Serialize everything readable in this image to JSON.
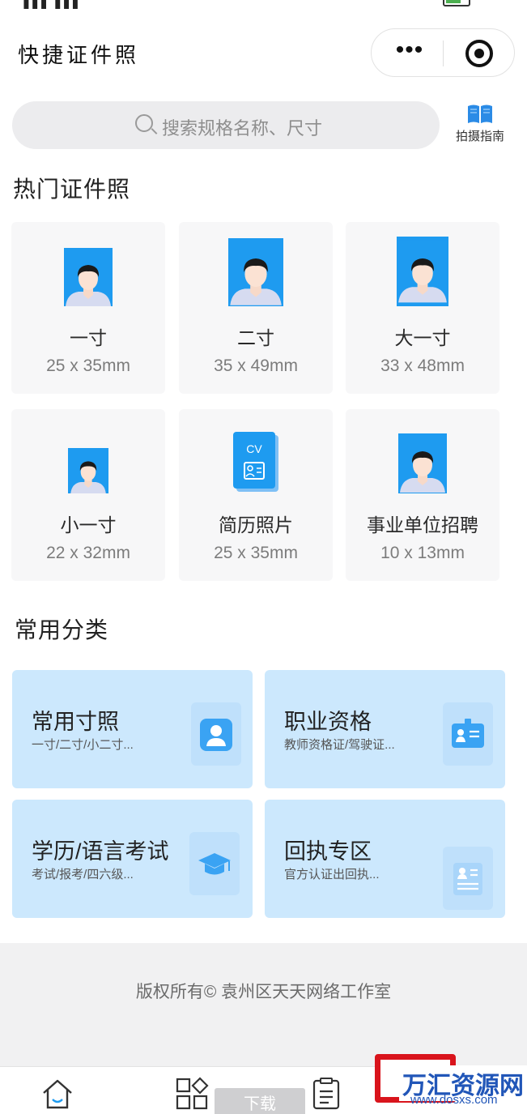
{
  "navbar": {
    "title": "快捷证件照",
    "more_glyph": "•••"
  },
  "search": {
    "placeholder": "搜索规格名称、尺寸"
  },
  "guide": {
    "label": "拍摄指南",
    "icon": "book-icon"
  },
  "hot": {
    "title": "热门证件照",
    "items": [
      {
        "name": "一寸",
        "size": "25 x 35mm",
        "icon": "portrait-photo-icon"
      },
      {
        "name": "二寸",
        "size": "35 x 49mm",
        "icon": "portrait-photo-icon"
      },
      {
        "name": "大一寸",
        "size": "33 x 48mm",
        "icon": "portrait-photo-icon"
      },
      {
        "name": "小一寸",
        "size": "22 x 32mm",
        "icon": "portrait-photo-icon"
      },
      {
        "name": "简历照片",
        "size": "25 x 35mm",
        "icon": "cv-icon",
        "badge": "CV"
      },
      {
        "name": "事业单位招聘",
        "size": "10 x 13mm",
        "icon": "portrait-photo-icon"
      }
    ]
  },
  "categories": {
    "title": "常用分类",
    "items": [
      {
        "name": "常用寸照",
        "sub": "一寸/二寸/小二寸...",
        "icon": "user-card-icon"
      },
      {
        "name": "职业资格",
        "sub": "教师资格证/驾驶证...",
        "icon": "id-badge-icon"
      },
      {
        "name": "学历/语言考试",
        "sub": "考试/报考/四六级...",
        "icon": "graduation-cap-icon"
      },
      {
        "name": "回执专区",
        "sub": "官方认证出回执...",
        "icon": "receipt-card-icon"
      }
    ]
  },
  "footer": {
    "copyright": "版权所有© 袁州区天天网络工作室"
  },
  "tabbar": {
    "tabs": [
      {
        "icon": "home-icon"
      },
      {
        "icon": "category-grid-icon"
      },
      {
        "icon": "clipboard-icon"
      }
    ],
    "download_label": "下载"
  },
  "watermark": {
    "text": "万汇资源网",
    "url": "www.dosxs.com"
  },
  "colors": {
    "accent": "#1e9bf0",
    "category_bg": "#cce8fd",
    "watermark_red": "#d9141c",
    "watermark_blue": "#2156b8"
  }
}
